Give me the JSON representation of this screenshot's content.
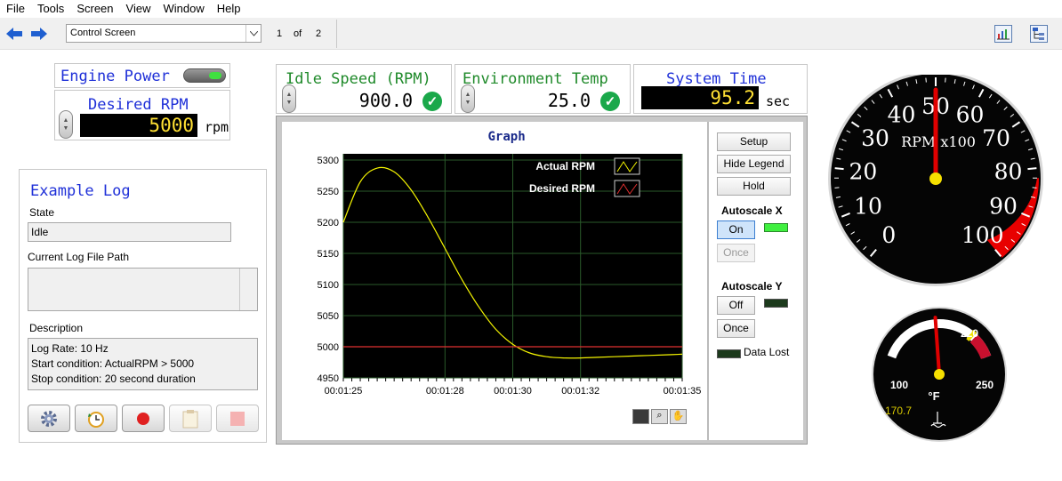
{
  "menu": [
    "File",
    "Tools",
    "Screen",
    "View",
    "Window",
    "Help"
  ],
  "toolbar": {
    "screen_name": "Control Screen",
    "page_current": "1",
    "page_of": "of",
    "page_total": "2"
  },
  "engine_power": {
    "label": "Engine Power",
    "state": "on"
  },
  "desired_rpm": {
    "label": "Desired RPM",
    "value": "5000",
    "unit": "rpm"
  },
  "idle_speed": {
    "label": "Idle Speed (RPM)",
    "value": "900.0"
  },
  "env_temp": {
    "label": "Environment Temp",
    "value": "25.0"
  },
  "system_time": {
    "label": "System Time",
    "value": "95.2",
    "unit": "sec"
  },
  "log": {
    "title": "Example Log",
    "state_label": "State",
    "state_value": "Idle",
    "path_label": "Current Log File Path",
    "path_value": "",
    "desc_label": "Description",
    "desc_lines": [
      "Log Rate: 10 Hz",
      "Start condition: ActualRPM > 5000",
      "Stop condition: 20 second duration"
    ]
  },
  "graph": {
    "title": "Graph",
    "legend": [
      {
        "name": "Actual RPM",
        "color": "#f4f400"
      },
      {
        "name": "Desired RPM",
        "color": "#e03030"
      }
    ],
    "setup": "Setup",
    "hide_legend": "Hide Legend",
    "hold": "Hold",
    "autoscale_x": "Autoscale X",
    "x_on": "On",
    "x_once": "Once",
    "autoscale_y": "Autoscale Y",
    "y_off": "Off",
    "y_once": "Once",
    "data_lost": "Data Lost"
  },
  "chart_data": {
    "type": "line",
    "title": "Graph",
    "xlabel": "",
    "ylabel": "",
    "x_ticks": [
      "00:01:25",
      "00:01:28",
      "00:01:30",
      "00:01:32",
      "00:01:35"
    ],
    "y_ticks": [
      4950,
      5000,
      5050,
      5100,
      5150,
      5200,
      5250,
      5300
    ],
    "ylim": [
      4950,
      5310
    ],
    "xlim": [
      85,
      95
    ],
    "series": [
      {
        "name": "Actual RPM",
        "color": "#f4f400",
        "x": [
          85,
          85.5,
          86,
          86.5,
          87,
          87.5,
          88,
          88.5,
          89,
          89.5,
          90,
          90.5,
          91,
          91.5,
          92,
          92.5,
          93,
          93.5,
          94,
          94.5,
          95
        ],
        "values": [
          5200,
          5265,
          5287,
          5281,
          5252,
          5208,
          5158,
          5108,
          5064,
          5028,
          5004,
          4990,
          4984,
          4982,
          4982,
          4983,
          4984,
          4985,
          4986,
          4987,
          4988
        ]
      },
      {
        "name": "Desired RPM",
        "color": "#e03030",
        "x": [
          85,
          95
        ],
        "values": [
          5000,
          5000
        ]
      }
    ]
  },
  "rpm_gauge": {
    "label": "RPM x100",
    "ticks": [
      "0",
      "10",
      "20",
      "30",
      "40",
      "50",
      "60",
      "70",
      "80",
      "90",
      "100"
    ],
    "value": 50
  },
  "temp_gauge": {
    "label_min": "100",
    "label_max": "250",
    "label_mark": "220",
    "unit": "°F",
    "readout": "170.7",
    "value": 170.7
  }
}
